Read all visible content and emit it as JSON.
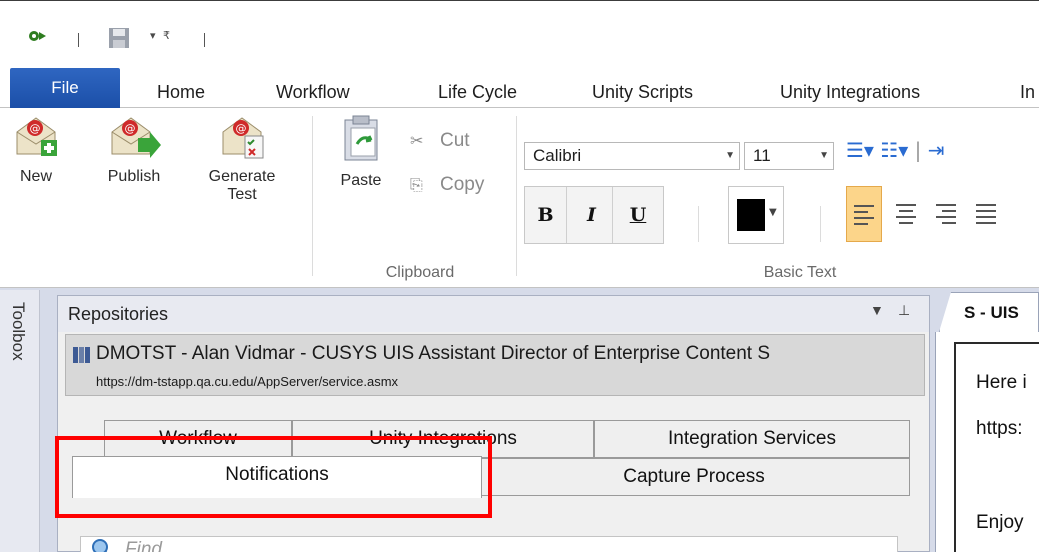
{
  "quick_access": {
    "icons": [
      "gear-run-icon",
      "save-icon",
      "customize-toolbar-icon"
    ]
  },
  "ribbon_tabs": [
    "File",
    "Home",
    "Workflow",
    "Life Cycle",
    "Unity Scripts",
    "Unity Integrations",
    "In"
  ],
  "ribbon": {
    "new_label": "New",
    "publish_label": "Publish",
    "generate_test_label_1": "Generate",
    "generate_test_label_2": "Test",
    "paste_label": "Paste",
    "cut_label": "Cut",
    "copy_label": "Copy",
    "clipboard_group": "Clipboard",
    "font_name": "Calibri",
    "font_size": "11",
    "bold": "B",
    "italic": "I",
    "underline": "U",
    "font_color": "#000000",
    "basic_text_group": "Basic Text"
  },
  "toolbox_label": "Toolbox",
  "repositories": {
    "title": "Repositories",
    "connection_name": "DMOTST - Alan Vidmar - CUSYS UIS Assistant Director of Enterprise Content S",
    "connection_url": "https://dm-tstapp.qa.cu.edu/AppServer/service.asmx",
    "tabs_row1": [
      "Workflow",
      "Unity Integrations",
      "Integration Services"
    ],
    "tabs_row2": [
      "Notifications",
      "Capture Process"
    ],
    "selected_tab": "Notifications",
    "find_placeholder": "Find"
  },
  "document": {
    "tab_label": "S - UIS",
    "lines": [
      "Here i",
      "https:",
      "Enjoy"
    ]
  },
  "colors": {
    "file_tab": "#1f55ad",
    "highlight": "#ff0000",
    "align_active": "#fcd58a"
  }
}
